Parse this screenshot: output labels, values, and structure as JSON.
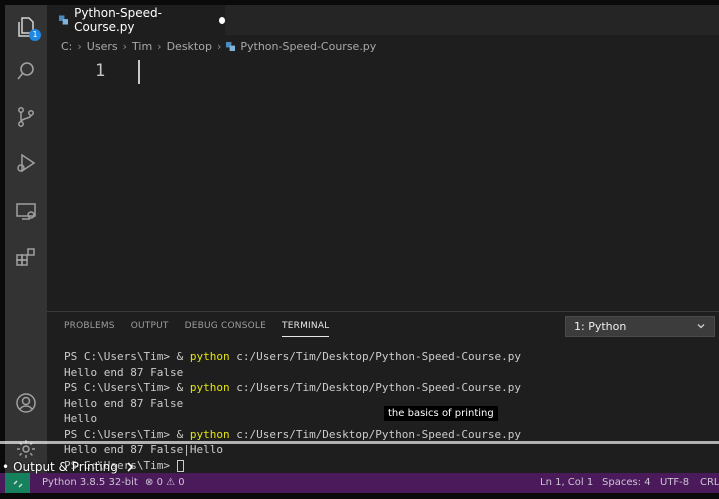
{
  "tab": {
    "filename": "Python-Speed-Course.py"
  },
  "activity_badge": "1",
  "breadcrumb": [
    "C:",
    "Users",
    "Tim",
    "Desktop",
    "Python-Speed-Course.py"
  ],
  "editor": {
    "line_number": "1"
  },
  "panel": {
    "tabs": [
      "PROBLEMS",
      "OUTPUT",
      "DEBUG CONSOLE",
      "TERMINAL"
    ],
    "active_tab": "TERMINAL",
    "terminal_select": "1: Python"
  },
  "terminal": {
    "prompt": "PS C:\\Users\\Tim> & ",
    "cmd": "python",
    "path": " c:/Users/Tim/Desktop/Python-Speed-Course.py",
    "out1": "Hello end 87 False",
    "out2": "Hello end 87 False",
    "out3": "Hello",
    "out4": "Hello end 87 False|Hello",
    "last_prompt": "PS C:\\Users\\Tim> "
  },
  "status": {
    "interpreter": "Python 3.8.5 32-bit",
    "errors": "0",
    "warnings": "0",
    "position": "Ln 1, Col 1",
    "spaces": "Spaces: 4",
    "encoding": "UTF-8",
    "eol": "CRL"
  },
  "video": {
    "chapter": "Output & Printing",
    "subtitle": "the basics of printing",
    "progress": 1.0
  },
  "colors": {
    "activity_bar": "#333333",
    "status_bar": "#4a1a5a",
    "terminal_keyword": "#e5e510",
    "badge": "#1e88e5"
  }
}
